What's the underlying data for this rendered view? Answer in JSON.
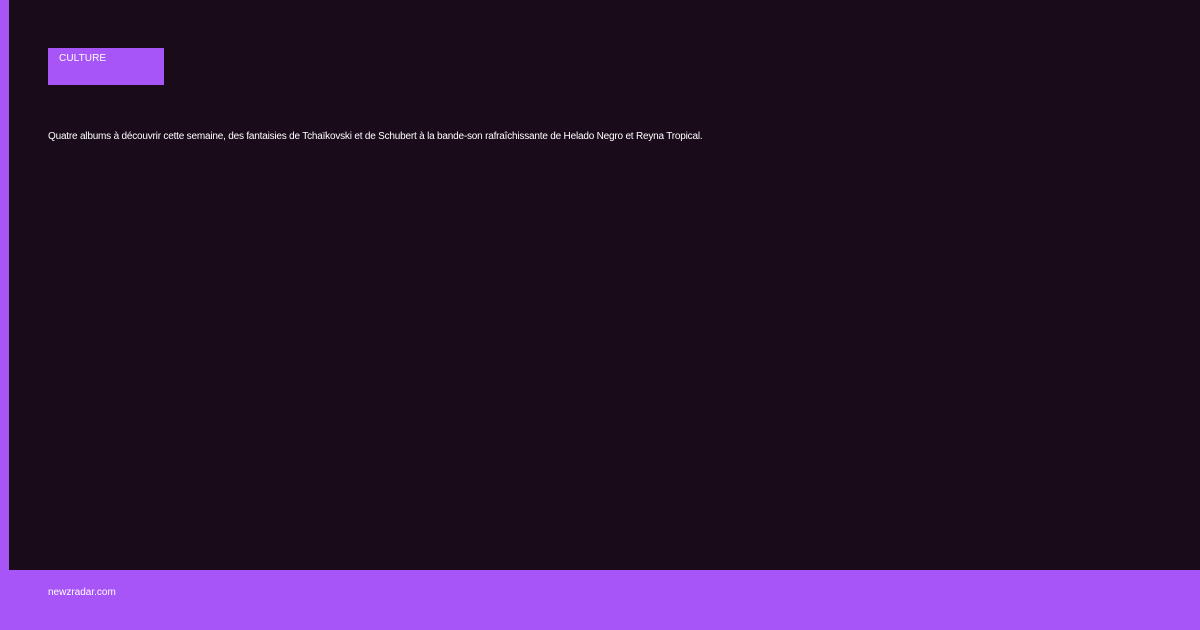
{
  "card": {
    "category": "CULTURE",
    "headline": "Quatre albums à découvrir cette semaine, des fantaisies de Tchaïkovski et de Schubert à la bande-son rafraîchissante de Helado Negro et Reyna Tropical.",
    "site": "newzradar.com"
  },
  "colors": {
    "accent": "#a855f7",
    "background": "#1a0b1b",
    "text": "#ffffff"
  }
}
